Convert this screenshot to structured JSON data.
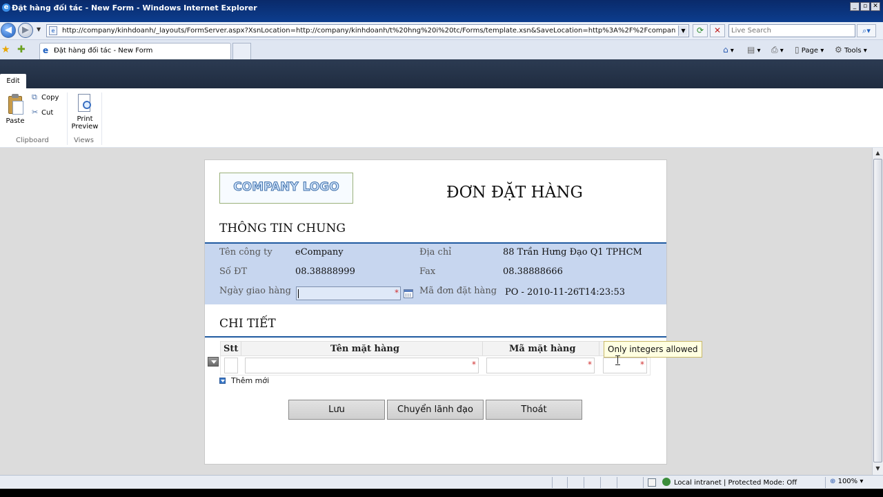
{
  "window": {
    "title": "Đặt hàng đối tác - New Form - Windows Internet Explorer",
    "controls": [
      "_",
      "▫",
      "✕"
    ]
  },
  "browser": {
    "url": "http://company/kinhdoanh/_layouts/FormServer.aspx?XsnLocation=http://company/kinhdoanh/t%20hng%20i%20tc/Forms/template.xsn&SaveLocation=http%3A%2F%2Fcompany%2Fkinhdoanh",
    "search_placeholder": "Live Search",
    "tab_title": "Đặt hàng đối tác - New Form",
    "commands": {
      "page": "Page",
      "tools": "Tools"
    },
    "status": {
      "zone": "Local intranet | Protected Mode: Off",
      "zoom": "100%"
    }
  },
  "ribbon": {
    "tab": "Edit",
    "clipboard": {
      "label": "Clipboard",
      "paste": "Paste",
      "copy": "Copy",
      "cut": "Cut"
    },
    "views": {
      "label": "Views",
      "print_line1": "Print",
      "print_line2": "Preview"
    }
  },
  "form": {
    "logo_text": "COMPANY LOGO",
    "title": "ĐƠN ĐẶT HÀNG",
    "general_section": "THÔNG TIN CHUNG",
    "fields": {
      "company_label": "Tên công ty",
      "company_value": "eCompany",
      "address_label": "Địa chỉ",
      "address_value": "88 Trần Hưng Đạo Q1 TPHCM",
      "phone_label": "Số ĐT",
      "phone_value": "08.38888999",
      "fax_label": "Fax",
      "fax_value": "08.38888666",
      "delivery_label": "Ngày giao hàng",
      "delivery_value": "",
      "order_label": "Mã đơn đặt hàng",
      "order_value": "PO - 2010-11-26T14:23:53"
    },
    "detail_section": "CHI TIẾT",
    "table": {
      "headers": [
        "Stt",
        "Tên mặt hàng",
        "Mã mặt hàng"
      ]
    },
    "add_new": "Thêm mới",
    "tooltip": "Only integers allowed",
    "required_mark": "*",
    "buttons": {
      "save": "Lưu",
      "forward": "Chuyển lãnh đạo",
      "exit": "Thoát"
    }
  },
  "colors": {
    "section_line": "#1f5aa0",
    "info_bg": "#c7d6ef",
    "required": "#d03030",
    "sp_band": "#2c3b52"
  }
}
